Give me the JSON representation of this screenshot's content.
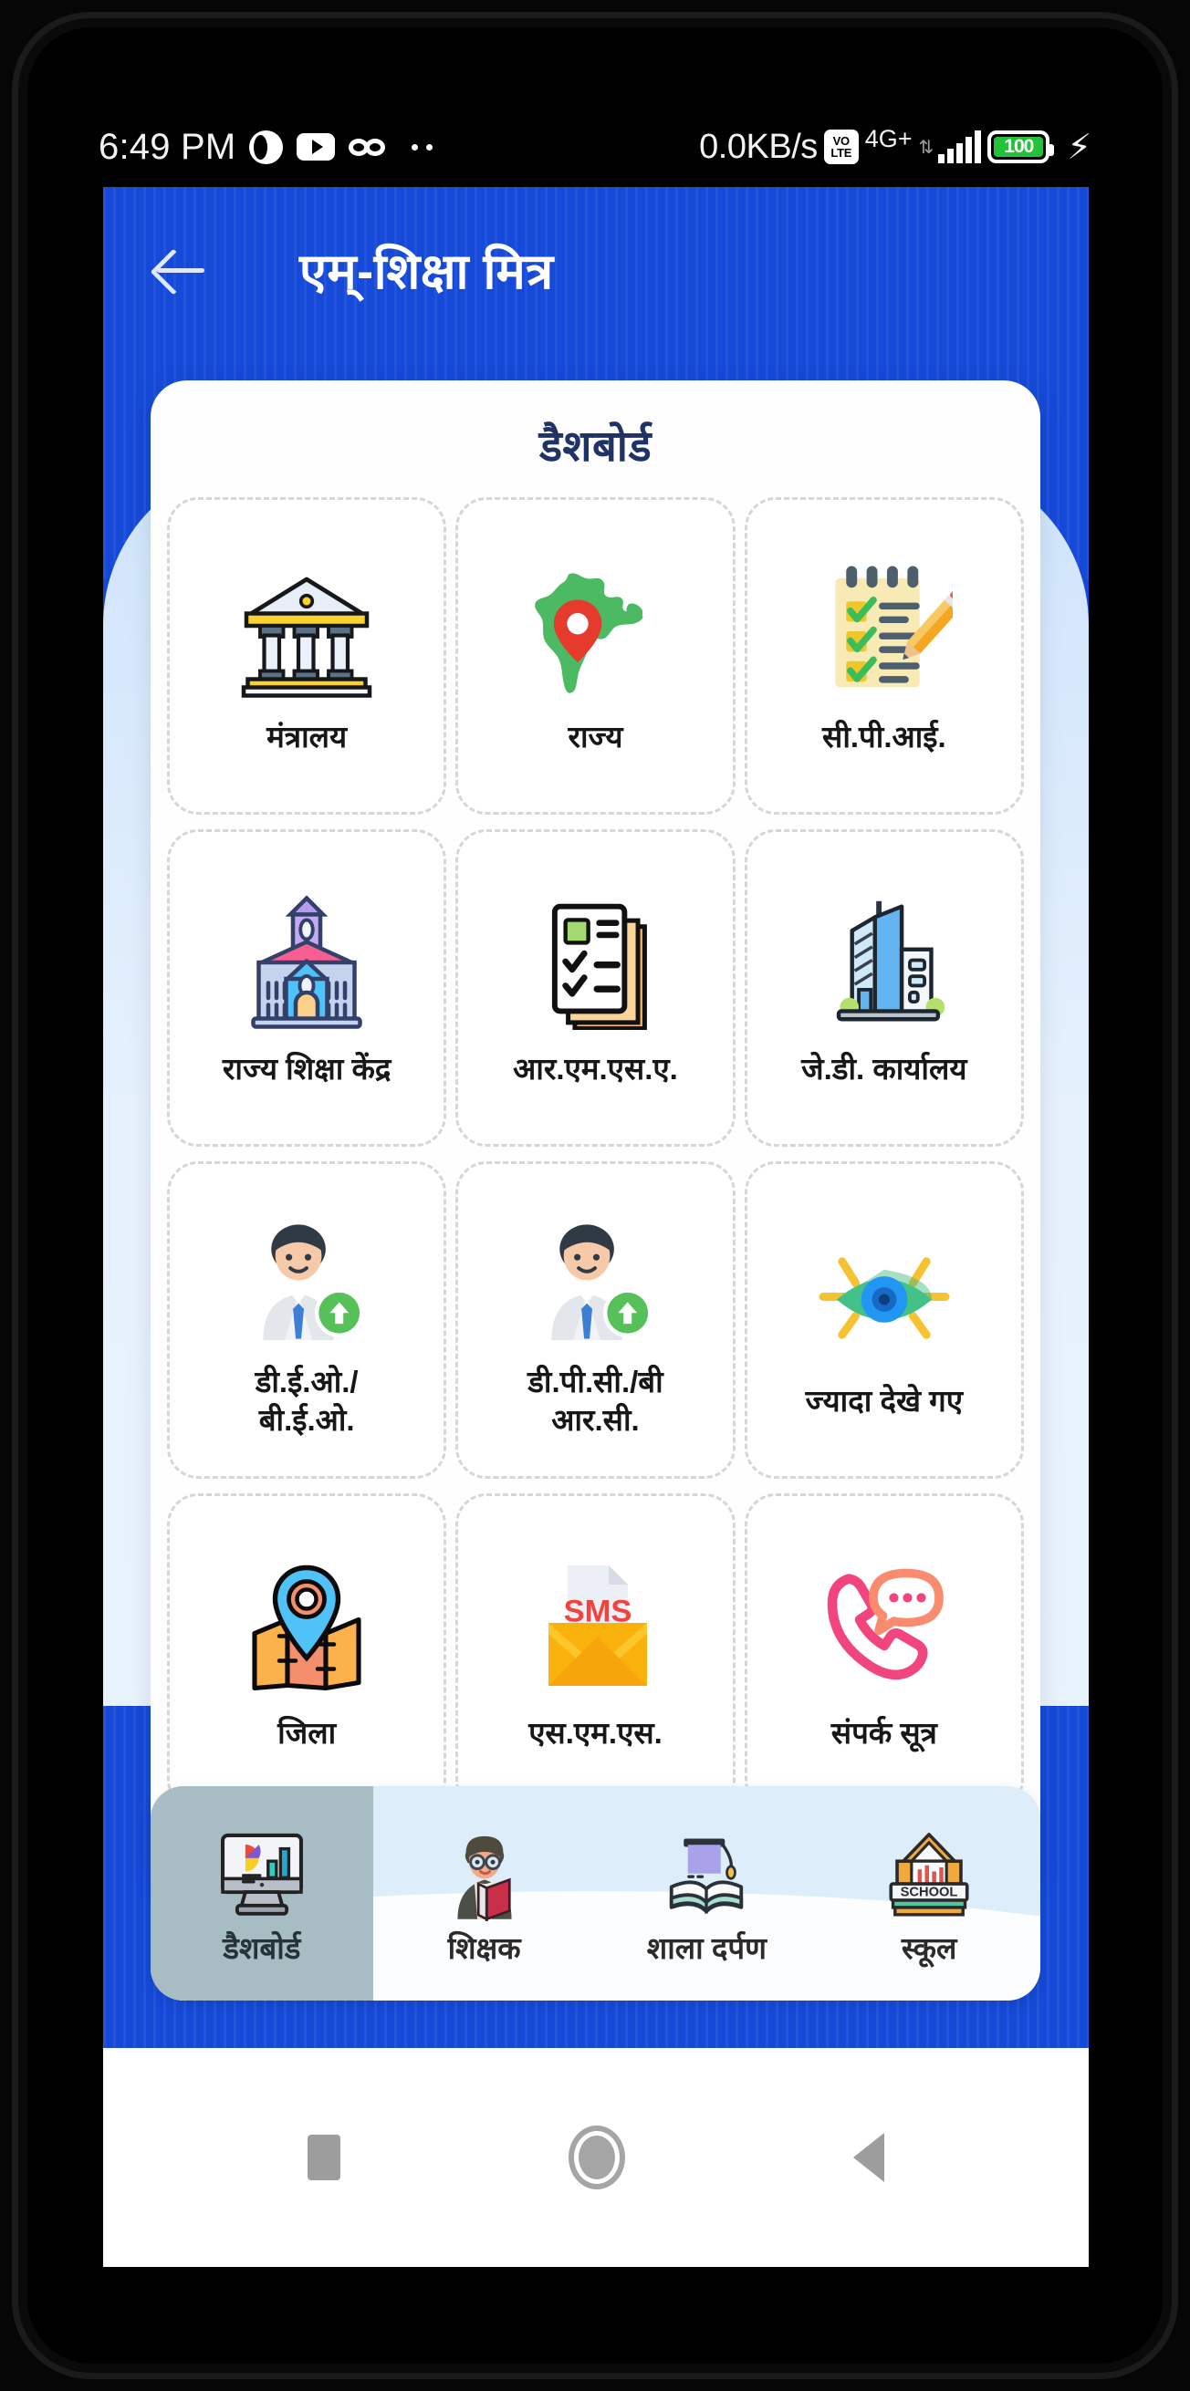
{
  "status_bar": {
    "time": "6:49 PM",
    "network_speed": "0.0KB/s",
    "volte_top": "VO",
    "volte_bottom": "LTE",
    "network_type": "4G+",
    "battery_level": "100",
    "charging_icon": "⚡",
    "icons": [
      "circle-percent-icon",
      "youtube-icon",
      "glasses-icon",
      "more-dots-icon"
    ]
  },
  "app_bar": {
    "back_icon": "back-arrow-icon",
    "title": "एम्-शिक्षा मित्र"
  },
  "dashboard": {
    "title": "डैशबोर्ड",
    "tiles": [
      {
        "label": "मंत्रालय",
        "icon": "government-building-icon"
      },
      {
        "label": "राज्य",
        "icon": "india-map-pin-icon"
      },
      {
        "label": "सी.पी.आई.",
        "icon": "checklist-notepad-pencil-icon"
      },
      {
        "label": "राज्य शिक्षा केंद्र",
        "icon": "school-building-icon"
      },
      {
        "label": "आर.एम.एस.ए.",
        "icon": "documents-checklist-icon"
      },
      {
        "label": "जे.डी. कार्यालय",
        "icon": "office-tower-icon"
      },
      {
        "label": "डी.ई.ओ./\nबी.ई.ओ.",
        "icon": "officer-upgrade-icon"
      },
      {
        "label": "डी.पी.सी./बी\nआर.सी.",
        "icon": "officer-upgrade-icon"
      },
      {
        "label": "ज्यादा देखे गए",
        "icon": "eye-views-icon"
      },
      {
        "label": "जिला",
        "icon": "map-location-icon"
      },
      {
        "label": "एस.एम.एस.",
        "icon": "sms-envelope-icon"
      },
      {
        "label": "संपर्क सूत्र",
        "icon": "phone-chat-icon"
      }
    ]
  },
  "bottom_nav": {
    "items": [
      {
        "label": "डैशबोर्ड",
        "icon": "dashboard-monitor-icon",
        "active": true
      },
      {
        "label": "शिक्षक",
        "icon": "teacher-icon",
        "active": false
      },
      {
        "label": "शाला दर्पण",
        "icon": "graduation-book-icon",
        "active": false
      },
      {
        "label": "स्कूल",
        "icon": "school-icon",
        "active": false
      }
    ]
  },
  "android_nav": {
    "recents": "square-recents-icon",
    "home": "circle-home-icon",
    "back": "triangle-back-icon"
  },
  "colors": {
    "brand_blue": "#1549d8",
    "card_title": "#1f3366",
    "light_bg": "#e6f1fd",
    "nav_bg": "#ddeefa",
    "nav_active": "#a8bcc4",
    "battery_green": "#24c13a"
  }
}
